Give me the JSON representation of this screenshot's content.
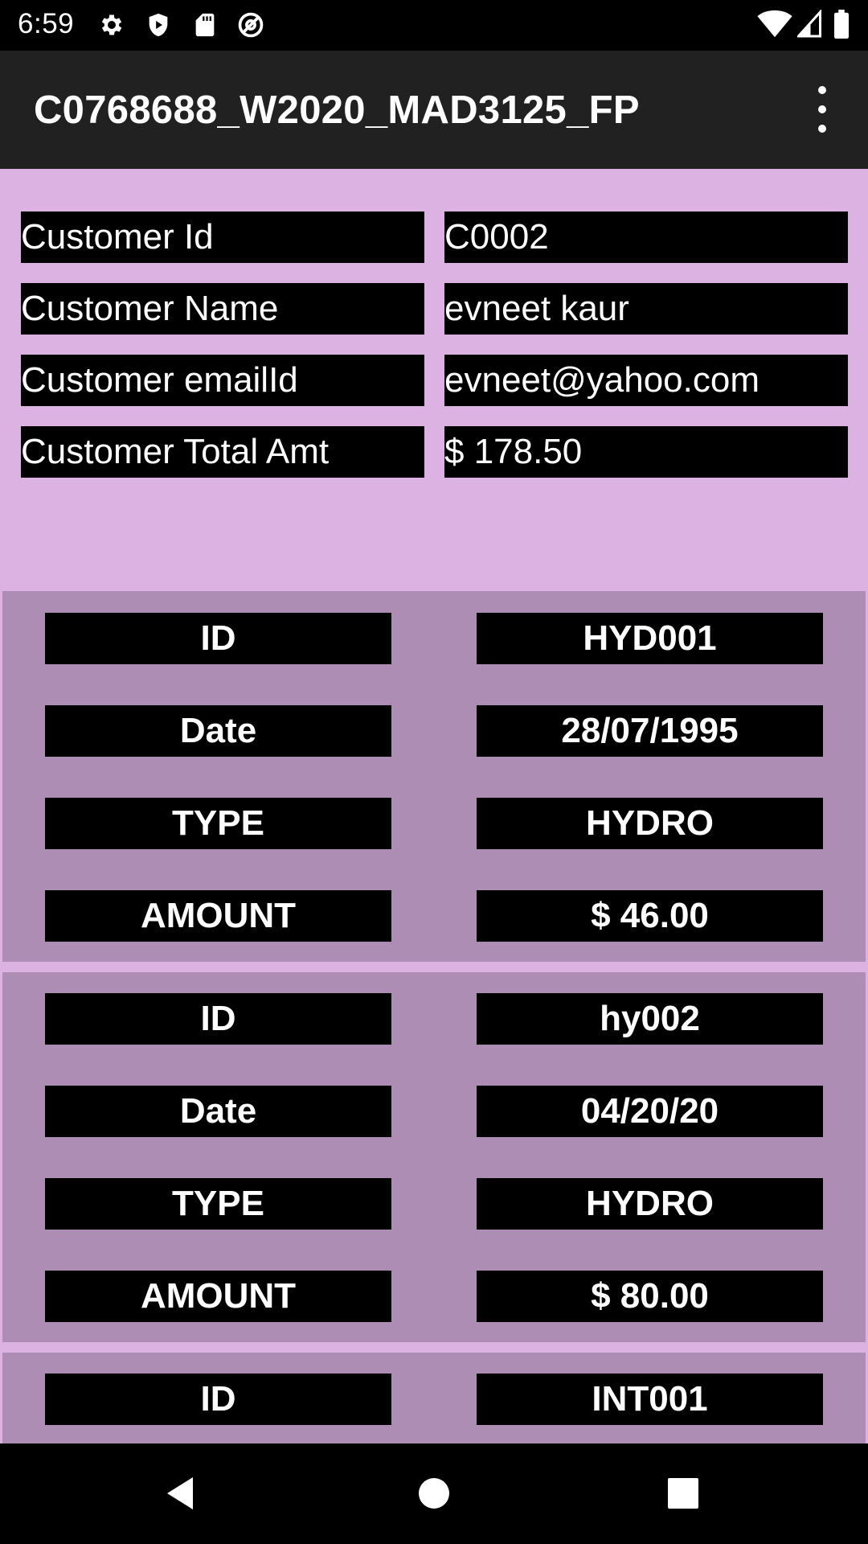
{
  "status_bar": {
    "time": "6:59",
    "left_icons": [
      "settings-icon",
      "shield-play-icon",
      "sd-card-icon",
      "at-sign-icon"
    ],
    "right_icons": [
      "wifi-icon",
      "cell-signal-icon",
      "battery-icon"
    ]
  },
  "toolbar": {
    "title": "C0768688_W2020_MAD3125_FP",
    "overflow_icon": "more-vert-icon"
  },
  "customer": {
    "rows": [
      {
        "label": "Customer Id",
        "value": "C0002"
      },
      {
        "label": "Customer Name",
        "value": "evneet kaur"
      },
      {
        "label": "Customer emailId",
        "value": "evneet@yahoo.com"
      },
      {
        "label": "Customer Total Amt",
        "value": "$ 178.50"
      }
    ]
  },
  "bills": [
    {
      "id_label": "ID",
      "id": "HYD001",
      "date_label": "Date",
      "date": "28/07/1995",
      "type_label": "TYPE",
      "type": "HYDRO",
      "amount_label": "AMOUNT",
      "amount": "$ 46.00"
    },
    {
      "id_label": "ID",
      "id": "hy002",
      "date_label": "Date",
      "date": "04/20/20",
      "type_label": "TYPE",
      "type": "HYDRO",
      "amount_label": "AMOUNT",
      "amount": "$ 80.00"
    },
    {
      "id_label": "ID",
      "id": "INT001"
    }
  ],
  "nav_bar": {
    "icons": [
      "back-icon",
      "home-icon",
      "recents-icon"
    ]
  },
  "colors": {
    "background": "#dcb2e2",
    "card": "#ae8db4",
    "toolbar": "#212121",
    "cell": "#000000",
    "text": "#ffffff"
  }
}
